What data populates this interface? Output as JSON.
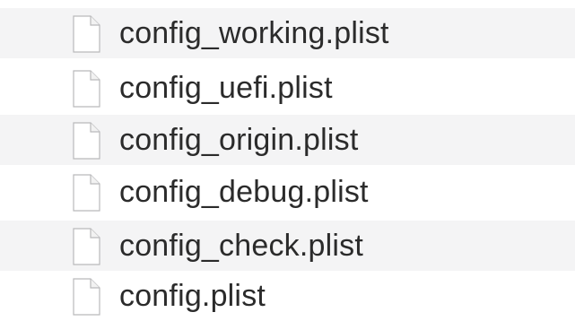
{
  "files": [
    {
      "name": "config_working.plist",
      "icon": "document-icon"
    },
    {
      "name": "config_uefi.plist",
      "icon": "document-icon"
    },
    {
      "name": "config_origin.plist",
      "icon": "document-icon"
    },
    {
      "name": "config_debug.plist",
      "icon": "document-icon"
    },
    {
      "name": "config_check.plist",
      "icon": "document-icon"
    },
    {
      "name": "config.plist",
      "icon": "document-icon"
    }
  ],
  "colors": {
    "stripe": "#f4f4f5",
    "background": "#ffffff",
    "text": "#2b2b2b"
  }
}
